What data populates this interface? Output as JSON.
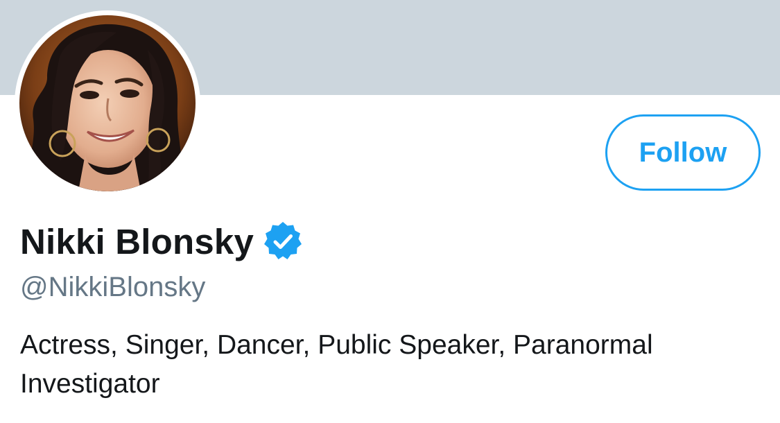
{
  "profile": {
    "display_name": "Nikki Blonsky",
    "handle": "@NikkiBlonsky",
    "verified": true,
    "bio": "Actress, Singer, Dancer, Public Speaker, Paranormal Investigator"
  },
  "actions": {
    "follow_label": "Follow"
  },
  "icons": {
    "verified": "verified-badge-icon",
    "avatar": "profile-photo"
  },
  "colors": {
    "banner": "#ccd6dd",
    "accent": "#1da1f2",
    "text_primary": "#14171a",
    "text_secondary": "#657786"
  }
}
